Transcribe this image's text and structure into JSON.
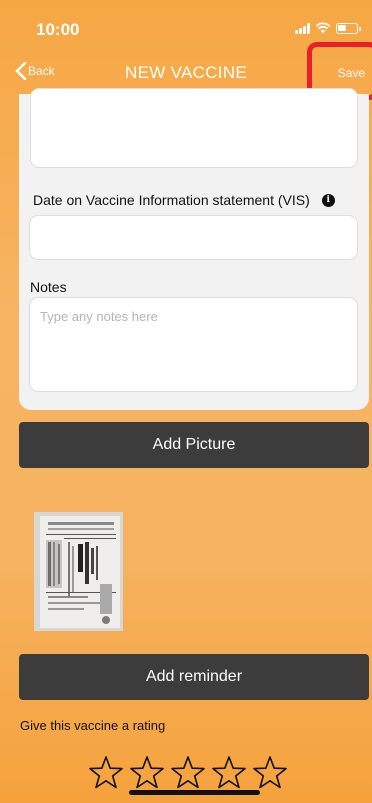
{
  "status_bar": {
    "time": "10:00",
    "icons": [
      "signal-icon",
      "wifi-icon",
      "battery-icon"
    ]
  },
  "nav": {
    "back_label": "Back",
    "title": "NEW VACCINE",
    "save_label": "Save"
  },
  "form": {
    "vis_label": "Date on Vaccine Information statement (VIS)",
    "vis_info_icon": "info-icon",
    "vis_value": "",
    "notes_label": "Notes",
    "notes_placeholder": "Type any notes here",
    "notes_value": ""
  },
  "actions": {
    "add_picture_label": "Add Picture",
    "add_reminder_label": "Add reminder"
  },
  "attachment": {
    "thumbnail_icon": "document-photo-thumbnail"
  },
  "rating": {
    "label": "Give this vaccine a rating",
    "max_stars": 5,
    "value": 0
  },
  "colors": {
    "background": "#f6a743",
    "button_dark": "#3c3c3c",
    "highlight": "#e8202a",
    "card": "#f2f2f2"
  }
}
